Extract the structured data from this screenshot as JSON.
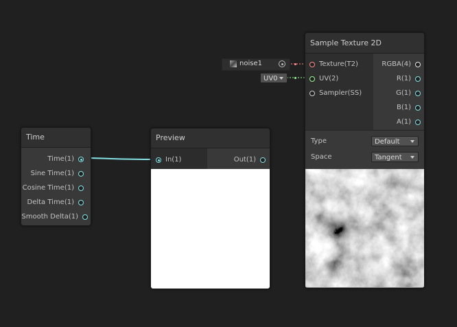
{
  "time_node": {
    "title": "Time",
    "outputs": [
      "Time(1)",
      "Sine Time(1)",
      "Cosine Time(1)",
      "Delta Time(1)",
      "Smooth Delta(1)"
    ]
  },
  "preview_node": {
    "title": "Preview",
    "input": "In(1)",
    "output": "Out(1)"
  },
  "sample_node": {
    "title": "Sample Texture 2D",
    "inputs": [
      "Texture(T2)",
      "UV(2)",
      "Sampler(SS)"
    ],
    "outputs": [
      "RGBA(4)",
      "R(1)",
      "G(1)",
      "B(1)",
      "A(1)"
    ],
    "type_label": "Type",
    "type_value": "Default",
    "space_label": "Space",
    "space_value": "Tangent"
  },
  "texture_field": {
    "value": "noise1"
  },
  "uv_field": {
    "value": "UV0"
  },
  "colors": {
    "background": "#202020",
    "node": "#393939",
    "vector1_port": "#84e4e7",
    "texture_port": "#ff8b8b",
    "uv_port": "#9bfd9b"
  }
}
